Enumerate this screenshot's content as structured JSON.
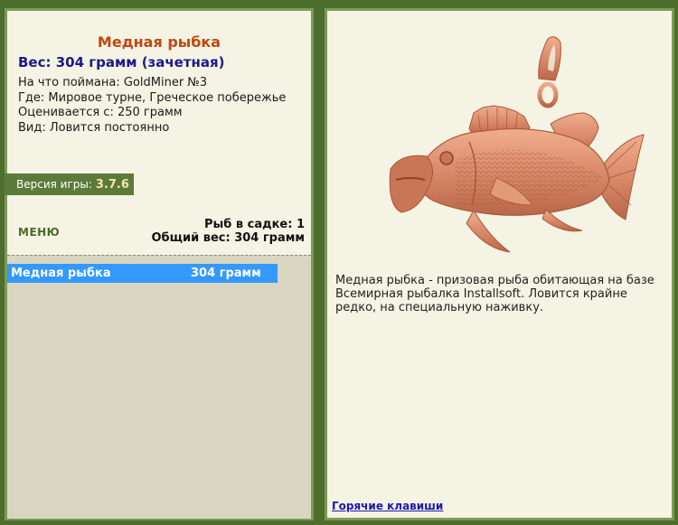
{
  "fish": {
    "name": "Медная рыбка",
    "weight_line": "Вес: 304 грамм (зачетная)",
    "caught_on": "На что поймана: GoldMiner №3",
    "where": "Где: Мировое турне, Греческое побережье",
    "valued_from": "Оценивается с: 250 грамм",
    "type": "Вид: Ловится постоянно",
    "description": "Медная рыбка - призовая рыба обитающая на базе Всемирная рыбалка Installsoft. Ловится крайне редко, на специальную наживку."
  },
  "version": {
    "label": "Версия игры:",
    "value": "3.7.6"
  },
  "menu_label": "МЕНЮ",
  "stats": {
    "count_line": "Рыб в садке: 1",
    "total_line": "Общий вес: 304 грамм"
  },
  "catch_list": [
    {
      "name": "Медная рыбка",
      "weight": "304 грамм"
    }
  ],
  "hotkeys_label": "Горячие клавиши",
  "colors": {
    "background": "#4e6e2e",
    "panel": "#f5f3e3",
    "border": "#7d9a57",
    "title": "#c04810",
    "weight": "#1a1a8a",
    "selected_row": "#3399ff",
    "list_bg": "#d8d6c0",
    "fish_copper": "#d98a6a"
  }
}
